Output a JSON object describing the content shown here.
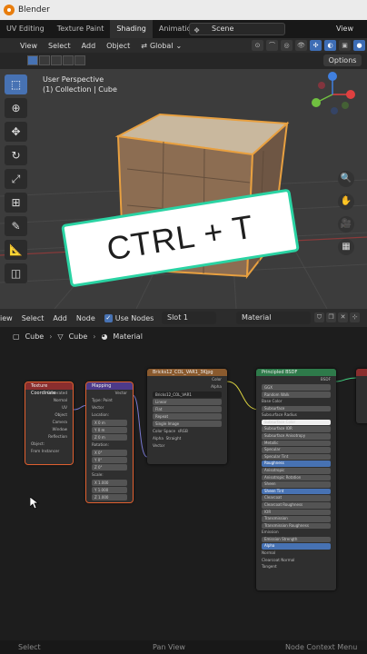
{
  "app": {
    "title": "Blender"
  },
  "workspace_tabs": [
    "UV Editing",
    "Texture Paint",
    "Shading",
    "Animation"
  ],
  "scene": {
    "label": "Scene",
    "view_layer": "View Lay"
  },
  "viewport_header": {
    "view": "View",
    "select": "Select",
    "add": "Add",
    "object": "Object",
    "transform": "Global",
    "options": "Options"
  },
  "viewport": {
    "perspective": "User Perspective",
    "collection": "(1) Collection | Cube"
  },
  "overlay": {
    "text": "CTRL + T"
  },
  "node_header": {
    "view": "iew",
    "select": "Select",
    "add": "Add",
    "node": "Node",
    "use_nodes": "Use Nodes",
    "slot": "Slot 1",
    "material": "Material"
  },
  "breadcrumb": {
    "object": "Cube",
    "mesh": "Cube",
    "material": "Material"
  },
  "nodes": {
    "texcoord": {
      "title": "Texture Coordinate",
      "outputs": [
        "Generated",
        "Normal",
        "UV",
        "Object",
        "Camera",
        "Window",
        "Reflection"
      ],
      "object_label": "Object:",
      "from_instancer": "From Instancer"
    },
    "mapping": {
      "title": "Mapping",
      "output": "Vector",
      "type_label": "Type:",
      "type_value": "Point",
      "vector": "Vector",
      "location": "Location:",
      "rotation": "Rotation:",
      "scale": "Scale:",
      "loc": [
        "X 0 m",
        "Y 0 m",
        "Z 0 m"
      ],
      "rot": [
        "X 0°",
        "Y 0°",
        "Z 0°"
      ],
      "sca": [
        "X 1.000",
        "Y 1.000",
        "Z 1.000"
      ]
    },
    "image": {
      "title": "Bricks12_COL_VAR1_3Kjpg",
      "outputs": [
        "Color",
        "Alpha"
      ],
      "image_name": "Bricks12_COL_VAR1",
      "interpolation": "Linear",
      "projection": "Flat",
      "extension": "Repeat",
      "source": "Single Image",
      "colorspace_label": "Color Space",
      "colorspace": "sRGB",
      "alpha_label": "Alpha",
      "alpha": "Straight",
      "vector": "Vector"
    },
    "principled": {
      "title": "Principled BSDF",
      "output": "BSDF",
      "distribution": "GGX",
      "subsurface_method": "Random Walk",
      "rows": [
        "Base Color",
        "Subsurface",
        "Subsurface Radius",
        "Subsurface Color",
        "Subsurface IOR",
        "Subsurface Anisotropy",
        "Metallic",
        "Specular",
        "Specular Tint",
        "Roughness",
        "Anisotropic",
        "Anisotropic Rotation",
        "Sheen",
        "Sheen Tint",
        "Clearcoat",
        "Clearcoat Roughness",
        "IOR",
        "Transmission",
        "Transmission Roughness",
        "Emission",
        "Emission Strength",
        "Alpha",
        "Normal",
        "Clearcoat Normal",
        "Tangent"
      ]
    }
  },
  "statusbar": {
    "select": "Select",
    "pan": "Pan View",
    "context": "Node Context Menu"
  },
  "colors": {
    "accent": "#4772b3",
    "overlay_border": "#2ad3a3",
    "selection": "#e8a040"
  }
}
